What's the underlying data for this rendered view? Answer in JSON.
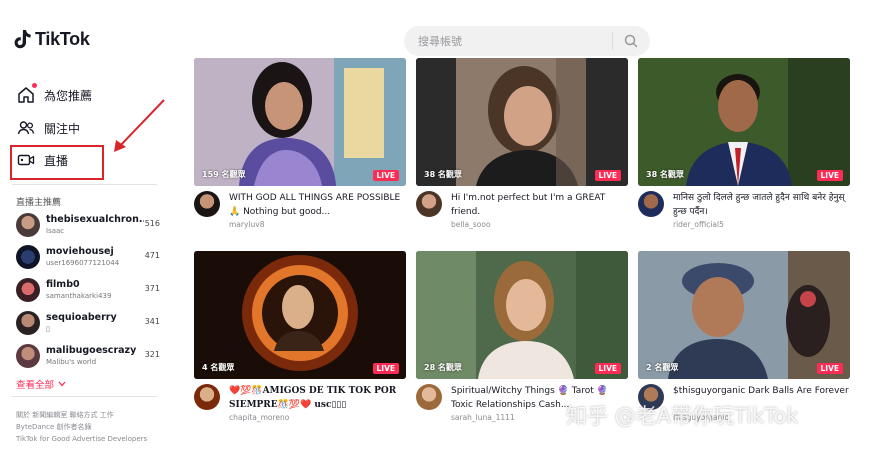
{
  "header": {
    "logo_text": "TikTok",
    "search_placeholder": "搜尋帳號"
  },
  "sidebar": {
    "nav": [
      {
        "label": "為您推薦",
        "icon": "home-icon"
      },
      {
        "label": "關注中",
        "icon": "following-users-icon"
      },
      {
        "label": "直播",
        "icon": "live-camera-icon"
      }
    ],
    "section_title": "直播主推薦",
    "streamers": [
      {
        "name": "thebisexualchron...",
        "sub": "Isaac",
        "count": "516"
      },
      {
        "name": "moviehousej",
        "sub": "user1696077121044",
        "count": "471"
      },
      {
        "name": "filmb0",
        "sub": "samanthakarki439",
        "count": "371"
      },
      {
        "name": "sequioaberry",
        "sub": "▯",
        "count": "341"
      },
      {
        "name": "malibugoescrazy",
        "sub": "Malibu's world",
        "count": "321"
      }
    ],
    "see_all": "查看全部",
    "footer_lines": [
      "關於  新聞編輯室  聯絡方式  工作",
      "ByteDance  創作者名錄",
      "TikTok for Good  Advertise  Developers"
    ]
  },
  "cards": [
    {
      "viewers": "159 名觀眾",
      "live": "LIVE",
      "title": "WITH GOD ALL THINGS ARE POSSIBLE🙏 Nothing but good...",
      "user": "maryluv8"
    },
    {
      "viewers": "38 名觀眾",
      "live": "LIVE",
      "title": "Hi I'm.not perfect but I'm a GREAT friend.",
      "user": "bella_sooo"
    },
    {
      "viewers": "38 名觀眾",
      "live": "LIVE",
      "title": "मानिस ठुलो दिलले हुन्छ जातले हुदैन साथि बनेर हेनुस् हुन्छ पर्दैन।",
      "user": "rider_official5"
    },
    {
      "viewers": "4 名觀眾",
      "live": "LIVE",
      "title": "❤️💯🎊AMIGOS DE TIK TOK POR SIEMPRE🎊💯❤️ usc▯▯▯",
      "user": "chapita_moreno"
    },
    {
      "viewers": "28 名觀眾",
      "live": "LIVE",
      "title": "Spiritual/Witchy Things 🔮 Tarot 🔮 Toxic Relationships Cash...",
      "user": "sarah_luna_1111"
    },
    {
      "viewers": "2 名觀眾",
      "live": "LIVE",
      "title": "$thisguyorganic Dark Balls Are Forever",
      "user": "thisguyorganic"
    }
  ],
  "watermark": "知乎 @老A带你玩TikTok",
  "colors": {
    "accent": "#fe2c55",
    "annotation": "#d8262d"
  }
}
